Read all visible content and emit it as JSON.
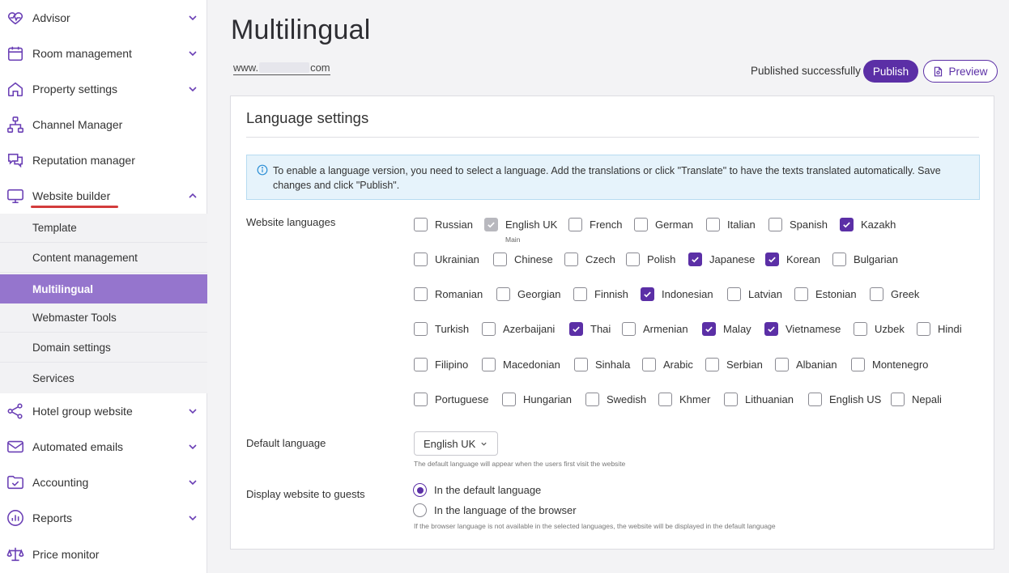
{
  "sidebar": {
    "items": [
      {
        "label": "Advisor",
        "icon": "heart-pulse-icon"
      },
      {
        "label": "Room management",
        "icon": "calendar-icon"
      },
      {
        "label": "Property settings",
        "icon": "house-icon"
      },
      {
        "label": "Channel Manager",
        "icon": "hierarchy-icon"
      },
      {
        "label": "Reputation manager",
        "icon": "chat-bubbles-icon"
      },
      {
        "label": "Website builder",
        "icon": "monitor-icon"
      },
      {
        "label": "Hotel group website",
        "icon": "share-nodes-icon"
      },
      {
        "label": "Automated emails",
        "icon": "envelope-icon"
      },
      {
        "label": "Accounting",
        "icon": "folder-check-icon"
      },
      {
        "label": "Reports",
        "icon": "bar-chart-circle-icon"
      },
      {
        "label": "Price monitor",
        "icon": "scales-icon"
      }
    ],
    "sub_items": [
      {
        "label": "Template"
      },
      {
        "label": "Content management"
      },
      {
        "label": "Multilingual"
      },
      {
        "label": "Webmaster Tools"
      },
      {
        "label": "Domain settings"
      },
      {
        "label": "Services"
      }
    ],
    "accent_color": "#9575cd",
    "underline_color": "#d33c3c"
  },
  "header": {
    "title": "Multilingual",
    "site_prefix": "www.",
    "site_suffix": "com",
    "status": "Published successfully",
    "publish_label": "Publish",
    "preview_label": "Preview",
    "brand_color": "#5b2fa6"
  },
  "panel": {
    "title": "Language settings",
    "info": "To enable a language version, you need to select a language. Add the translations or click \"Translate\" to have the texts translated automatically. Save changes and click \"Publish\".",
    "website_languages_label": "Website languages",
    "main_note": "Main",
    "languages": [
      {
        "label": "Russian",
        "checked": false
      },
      {
        "label": "English UK",
        "checked": true,
        "disabled": true
      },
      {
        "label": "French",
        "checked": false
      },
      {
        "label": "German",
        "checked": false
      },
      {
        "label": "Italian",
        "checked": false
      },
      {
        "label": "Spanish",
        "checked": false
      },
      {
        "label": "Kazakh",
        "checked": true
      },
      {
        "label": "Ukrainian",
        "checked": false
      },
      {
        "label": "Chinese",
        "checked": false
      },
      {
        "label": "Czech",
        "checked": false
      },
      {
        "label": "Polish",
        "checked": false
      },
      {
        "label": "Japanese",
        "checked": true
      },
      {
        "label": "Korean",
        "checked": true
      },
      {
        "label": "Bulgarian",
        "checked": false
      },
      {
        "label": "Romanian",
        "checked": false
      },
      {
        "label": "Georgian",
        "checked": false
      },
      {
        "label": "Finnish",
        "checked": false
      },
      {
        "label": "Indonesian",
        "checked": true
      },
      {
        "label": "Latvian",
        "checked": false
      },
      {
        "label": "Estonian",
        "checked": false
      },
      {
        "label": "Greek",
        "checked": false
      },
      {
        "label": "Turkish",
        "checked": false
      },
      {
        "label": "Azerbaijani",
        "checked": false
      },
      {
        "label": "Thai",
        "checked": true
      },
      {
        "label": "Armenian",
        "checked": false
      },
      {
        "label": "Malay",
        "checked": true
      },
      {
        "label": "Vietnamese",
        "checked": true
      },
      {
        "label": "Uzbek",
        "checked": false
      },
      {
        "label": "Hindi",
        "checked": false
      },
      {
        "label": "Filipino",
        "checked": false
      },
      {
        "label": "Macedonian",
        "checked": false
      },
      {
        "label": "Sinhala",
        "checked": false
      },
      {
        "label": "Arabic",
        "checked": false
      },
      {
        "label": "Serbian",
        "checked": false
      },
      {
        "label": "Albanian",
        "checked": false
      },
      {
        "label": "Montenegro",
        "checked": false
      },
      {
        "label": "Portuguese",
        "checked": false
      },
      {
        "label": "Hungarian",
        "checked": false
      },
      {
        "label": "Swedish",
        "checked": false
      },
      {
        "label": "Khmer",
        "checked": false
      },
      {
        "label": "Lithuanian",
        "checked": false
      },
      {
        "label": "English US",
        "checked": false
      },
      {
        "label": "Nepali",
        "checked": false
      }
    ],
    "default_language_label": "Default language",
    "default_language_value": "English UK",
    "default_language_hint": "The default language will appear when the users first visit the website",
    "display_label": "Display website to guests",
    "display_options": [
      {
        "label": "In the default language",
        "selected": true
      },
      {
        "label": "In the language of the browser",
        "selected": false
      }
    ],
    "display_hint": "If the browser language is not available in the selected languages, the website will be displayed in the default language"
  }
}
